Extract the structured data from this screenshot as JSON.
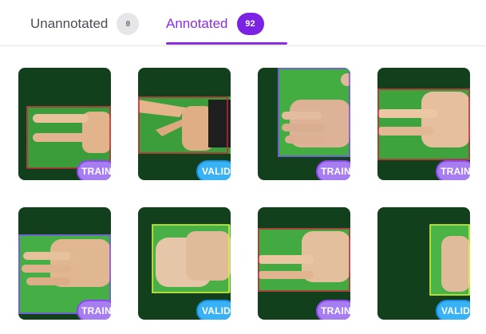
{
  "tabs": {
    "unannotated": {
      "label": "Unannotated",
      "count": "0"
    },
    "annotated": {
      "label": "Annotated",
      "count": "92"
    }
  },
  "colors": {
    "accent": "#8b2be2",
    "train_badge": "#a77ef2",
    "valid_badge": "#38b2f5",
    "bbox_train": "#c8233a",
    "bbox_valid": "#d9f53c"
  },
  "cards": [
    {
      "split": "TRAIN",
      "subject": "hand-two-fingers"
    },
    {
      "split": "VALID",
      "subject": "hand-two-fingers"
    },
    {
      "split": "TRAIN",
      "subject": "hand-flat"
    },
    {
      "split": "TRAIN",
      "subject": "hand-two-fingers"
    },
    {
      "split": "TRAIN",
      "subject": "hand-flat"
    },
    {
      "split": "VALID",
      "subject": "hand-fist"
    },
    {
      "split": "TRAIN",
      "subject": "hand-two-fingers"
    },
    {
      "split": "VALID",
      "subject": "hand-fist"
    }
  ]
}
